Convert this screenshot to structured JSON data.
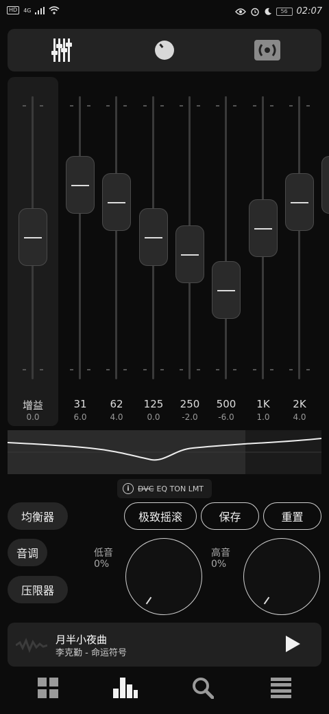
{
  "status_bar": {
    "hd": "HD",
    "network": "4G",
    "time": "02:07",
    "battery": "56"
  },
  "top_tabs": [
    {
      "name": "equalizer-tab",
      "icon": "sliders-icon"
    },
    {
      "name": "tone-tab",
      "icon": "knob-icon"
    },
    {
      "name": "surround-tab",
      "icon": "speaker-radiate-icon"
    }
  ],
  "eq": {
    "gain": {
      "label": "增益",
      "value": "0.0"
    },
    "bands": [
      {
        "label": "31",
        "value": "6.0"
      },
      {
        "label": "62",
        "value": "4.0"
      },
      {
        "label": "125",
        "value": "0.0"
      },
      {
        "label": "250",
        "value": "-2.0"
      },
      {
        "label": "500",
        "value": "-6.0"
      },
      {
        "label": "1K",
        "value": "1.0"
      },
      {
        "label": "2K",
        "value": "4.0"
      }
    ]
  },
  "info": {
    "struck": "DVC",
    "text": "EQ TON LMT"
  },
  "side_buttons": {
    "equalizer": "均衡器",
    "tone": "音调",
    "limiter": "压限器"
  },
  "action_buttons": {
    "extreme_rock": "极致摇滚",
    "save": "保存",
    "reset": "重置"
  },
  "bass": {
    "label": "低音",
    "value": "0%"
  },
  "treble": {
    "label": "高音",
    "value": "0%"
  },
  "now_playing": {
    "title": "月半小夜曲",
    "artist": "李克勤 - 命运符号"
  },
  "bottom_nav": [
    {
      "name": "nav-library",
      "icon": "grid-icon"
    },
    {
      "name": "nav-equalizer",
      "icon": "bar-chart-icon"
    },
    {
      "name": "nav-search",
      "icon": "search-icon"
    },
    {
      "name": "nav-menu",
      "icon": "menu-icon"
    }
  ]
}
